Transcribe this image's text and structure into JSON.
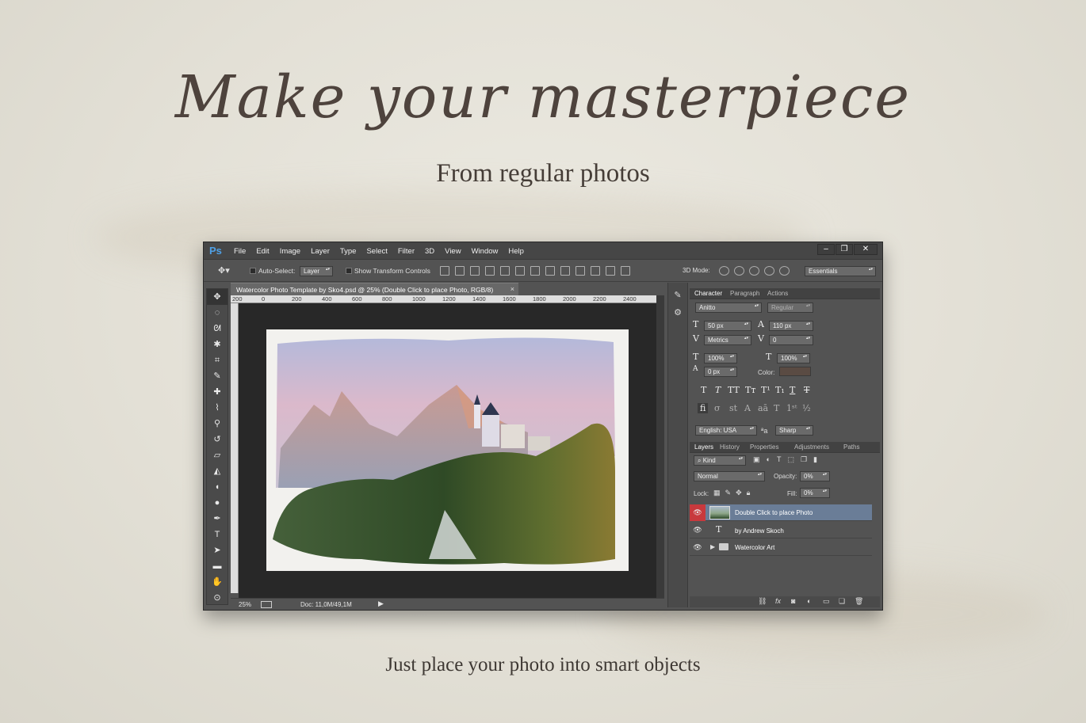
{
  "hero": {
    "headline": "Make your masterpiece",
    "subtitle": "From regular photos",
    "tagline": "Just place your photo into smart objects"
  },
  "app": {
    "logo": "Ps",
    "menu": [
      "File",
      "Edit",
      "Image",
      "Layer",
      "Type",
      "Select",
      "Filter",
      "3D",
      "View",
      "Window",
      "Help"
    ],
    "window_controls": [
      "–",
      "❐",
      "✕"
    ]
  },
  "options_bar": {
    "auto_select_label": "Auto-Select:",
    "auto_select_value": "Layer",
    "show_transform_label": "Show Transform Controls",
    "mode_3d_label": "3D Mode:",
    "workspace_value": "Essentials"
  },
  "document": {
    "tab_title": "Watercolor Photo Template by Sko4.psd @ 25% (Double Click to place Photo, RGB/8)",
    "tab_close": "×",
    "ruler_ticks": [
      "200",
      "0",
      "200",
      "400",
      "600",
      "800",
      "1000",
      "1200",
      "1400",
      "1600",
      "1800",
      "2000",
      "2200",
      "2400"
    ],
    "zoom": "25%",
    "doc_info": "Doc: 11,0M/49,1M"
  },
  "character_panel": {
    "tabs": [
      "Character",
      "Paragraph",
      "Actions"
    ],
    "font_family": "Anitto",
    "font_style": "Regular",
    "font_size": "50 px",
    "leading": "110 px",
    "kerning": "Metrics",
    "tracking": "0",
    "vertical_scale": "100%",
    "horizontal_scale": "100%",
    "baseline_shift": "0 px",
    "color_label": "Color:",
    "language": "English: USA",
    "aa_label": "a",
    "antialias": "Sharp",
    "color_swatch": "#5a4b43"
  },
  "layers_panel": {
    "tabs": [
      "Layers",
      "History",
      "Properties",
      "Adjustments",
      "Paths"
    ],
    "filter_kind": "Kind",
    "blend_mode": "Normal",
    "opacity_label": "Opacity:",
    "opacity": "0%",
    "lock_label": "Lock:",
    "fill_label": "Fill:",
    "fill": "0%",
    "layers": [
      {
        "name": "Double Click to place Photo",
        "type": "smart-object",
        "selected": true
      },
      {
        "name": "by Andrew  Skoch",
        "type": "text",
        "selected": false
      },
      {
        "name": "Watercolor Art",
        "type": "group",
        "selected": false
      }
    ],
    "bottom_icons": [
      "link-icon",
      "fx-icon",
      "mask-icon",
      "adjustment-icon",
      "folder-icon",
      "new-layer-icon",
      "trash-icon"
    ]
  }
}
